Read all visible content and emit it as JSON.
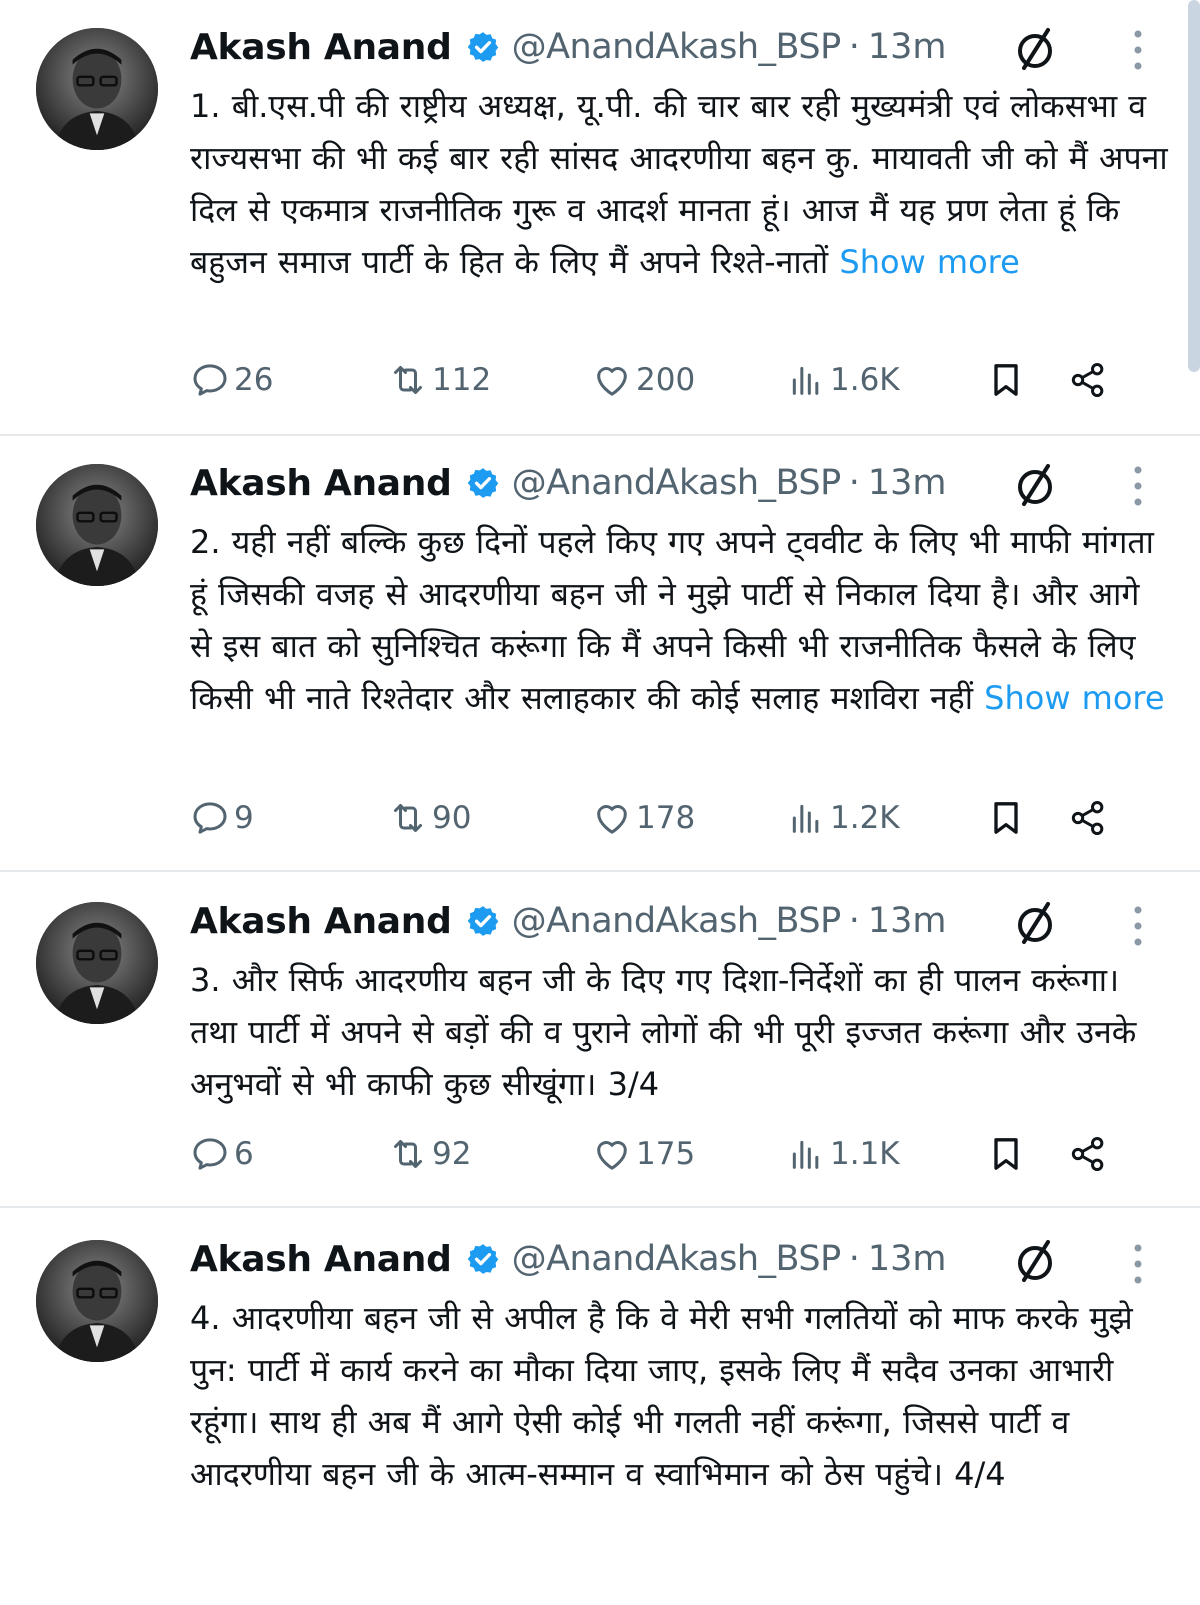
{
  "tweets": [
    {
      "name": "Akash Anand",
      "handle": "@AnandAkash_BSP",
      "separator": "·",
      "time": "13m",
      "text": "1. बी.एस.पी की राष्ट्रीय अध्यक्ष, यू.पी. की चार बार रही मुख्यमंत्री एवं लोकसभा व राज्यसभा की भी कई बार रही सांसद आदरणीया बहन कु. मायावती जी को मैं अपना दिल से एकमात्र राजनीतिक गुरू व आदर्श मानता हूं। आज मैं यह प्रण लेता हूं कि बहुजन समाज पार्टी के हित के लिए मैं अपने रिश्ते-नातों ",
      "show_more": "Show more",
      "replies": "26",
      "reposts": "112",
      "likes": "200",
      "views": "1.6K"
    },
    {
      "name": "Akash Anand",
      "handle": "@AnandAkash_BSP",
      "separator": "·",
      "time": "13m",
      "text": "2. यही नहीं बल्कि कुछ दिनों पहले किए गए अपने ट्ववीट के लिए भी माफी मांगता हूं जिसकी वजह से आदरणीया बहन जी ने मुझे पार्टी से निकाल दिया है। और आगे से इस बात को सुनिश्चित करूंगा कि मैं अपने किसी भी राजनीतिक फैसले के लिए किसी भी नाते रिश्तेदार और सलाहकार की कोई सलाह मशविरा नहीं ",
      "show_more": "Show more",
      "replies": "9",
      "reposts": "90",
      "likes": "178",
      "views": "1.2K"
    },
    {
      "name": "Akash Anand",
      "handle": "@AnandAkash_BSP",
      "separator": "·",
      "time": "13m",
      "text": "3. और सिर्फ आदरणीय बहन जी के दिए गए दिशा-निर्देशों का ही पालन करूंगा। तथा पार्टी में अपने से बड़ों की व पुराने लोगों की भी पूरी इज्जत करूंगा और उनके अनुभवों से भी काफी कुछ सीखूंगा। 3/4",
      "show_more": "",
      "replies": "6",
      "reposts": "92",
      "likes": "175",
      "views": "1.1K"
    },
    {
      "name": "Akash Anand",
      "handle": "@AnandAkash_BSP",
      "separator": "·",
      "time": "13m",
      "text": "4. आदरणीया बहन जी से अपील है कि वे मेरी सभी गलतियों को माफ करके मुझे पुन: पार्टी में कार्य करने का मौका दिया जाए, इसके लिए मैं सदैव उनका आभारी रहूंगा। साथ ही अब मैं आगे ऐसी कोई भी गलती नहीं करूंगा, जिससे पार्टी व आदरणीया बहन जी के आत्म-सम्मान व स्वाभिमान को ठेस पहुंचे। 4/4",
      "show_more": ""
    }
  ],
  "colors": {
    "link": "#1d9bf0",
    "muted": "#536471",
    "text": "#0f1419",
    "verified": "#1d9bf0"
  },
  "icons": [
    "verified-badge-icon",
    "grok-icon",
    "more-options-icon",
    "reply-icon",
    "repost-icon",
    "like-icon",
    "views-icon",
    "bookmark-icon",
    "share-icon"
  ]
}
